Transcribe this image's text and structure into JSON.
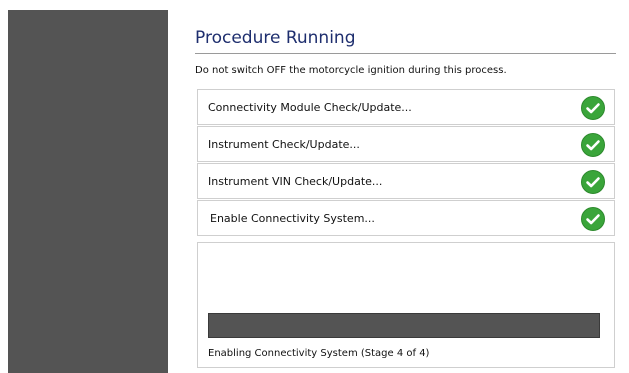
{
  "header": {
    "title": "Procedure Running",
    "notice": "Do not switch OFF the motorcycle ignition during this process."
  },
  "steps": [
    {
      "label": "Connectivity Module Check/Update...",
      "status": "complete",
      "icon": "check-circle-icon"
    },
    {
      "label": "Instrument Check/Update...",
      "status": "complete",
      "icon": "check-circle-icon"
    },
    {
      "label": "Instrument VIN Check/Update...",
      "status": "complete",
      "icon": "check-circle-icon"
    },
    {
      "label": "Enable Connectivity System...",
      "status": "complete",
      "icon": "check-circle-icon"
    }
  ],
  "progress": {
    "status_text": "Enabling Connectivity System (Stage 4 of 4)",
    "fraction": 1.0
  },
  "colors": {
    "sidebar": "#545454",
    "title": "#1e2e6e",
    "check_green": "#3aa53a",
    "progress_bar": "#545454"
  }
}
